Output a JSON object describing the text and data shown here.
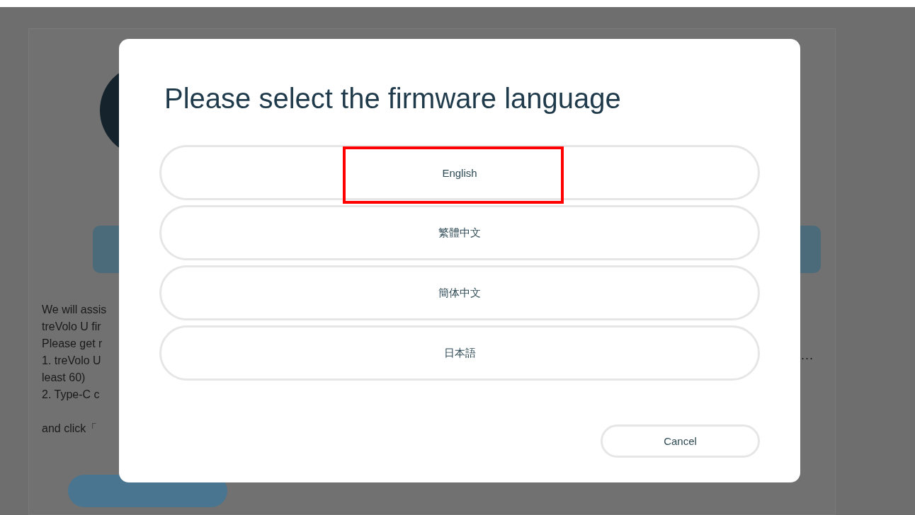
{
  "background": {
    "intro_lines": [
      "We will assis",
      "treVolo U fir",
      "Please get r",
      "1. treVolo U",
      "least 60)",
      "2. Type-C c"
    ],
    "action_line": "and click「",
    "trailing_dots": "..."
  },
  "dialog": {
    "title": "Please select the firmware language",
    "options": [
      {
        "label": "English",
        "highlighted": true
      },
      {
        "label": "繁體中文",
        "highlighted": false
      },
      {
        "label": "簡体中文",
        "highlighted": false
      },
      {
        "label": "日本語",
        "highlighted": false
      }
    ],
    "cancel": "Cancel"
  }
}
